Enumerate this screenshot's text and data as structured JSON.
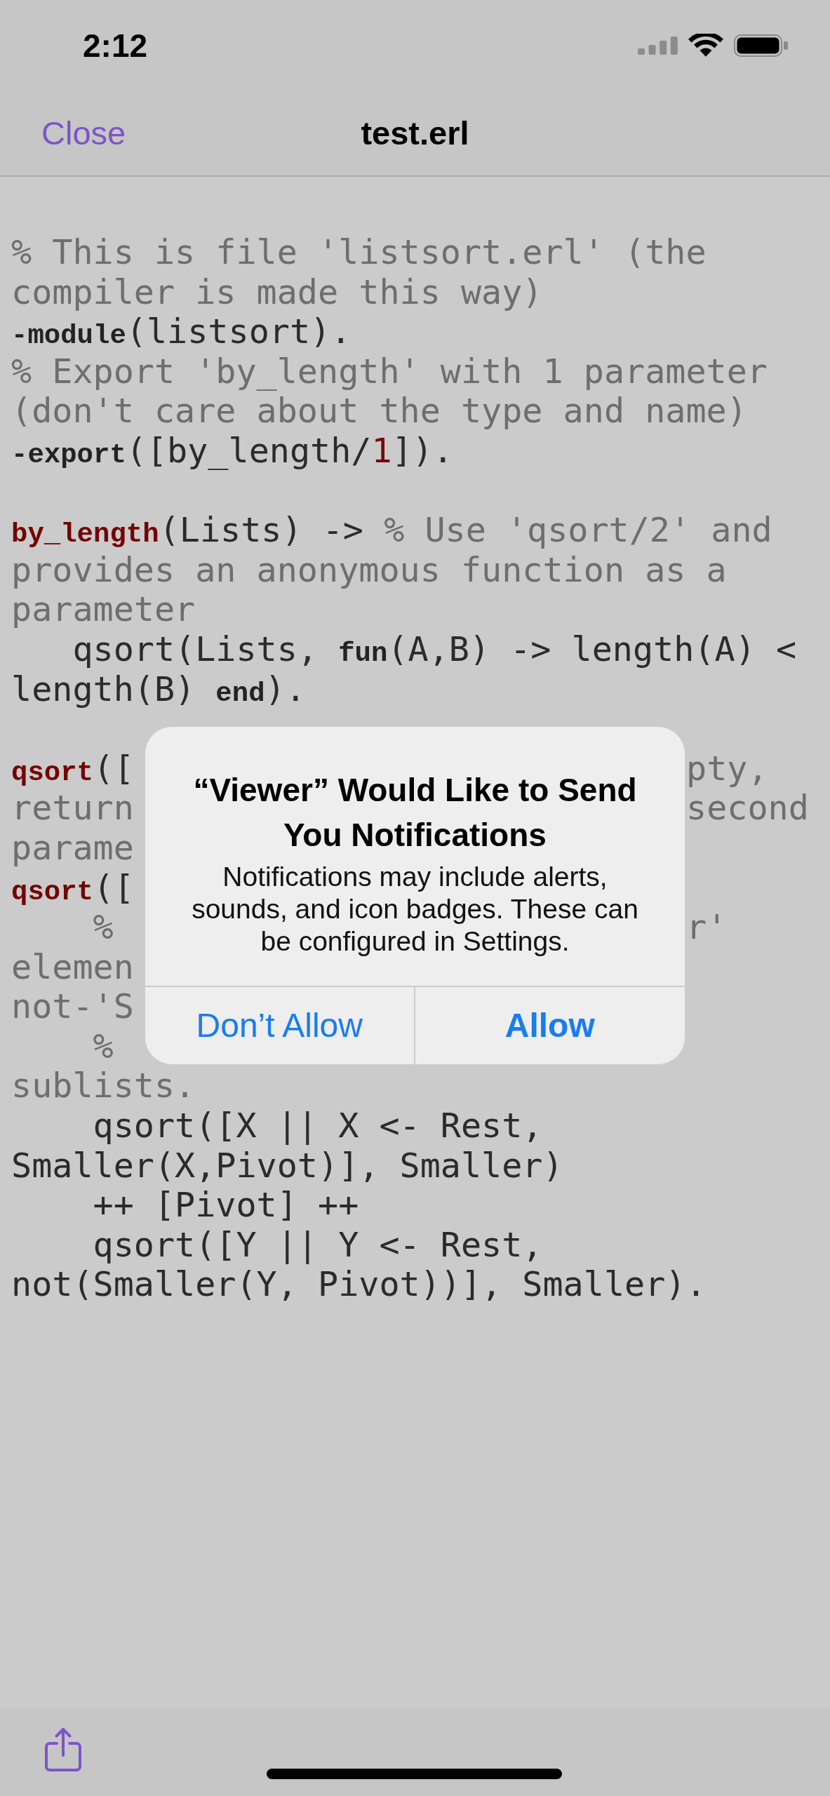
{
  "status_bar": {
    "time": "2:12"
  },
  "nav_bar": {
    "close_button": "Close",
    "title": "test.erl"
  },
  "editor": {
    "blocks": [
      {
        "lines": [
          {
            "tokens": [
              {
                "kind": "comment",
                "text": "% This is file 'listsort.erl' (the"
              }
            ]
          },
          {
            "tokens": [
              {
                "kind": "comment",
                "text": "compiler is made this way)"
              }
            ]
          },
          {
            "tokens": [
              {
                "kind": "keyword",
                "text": "-module"
              },
              {
                "kind": "plain",
                "text": "(listsort)."
              }
            ]
          },
          {
            "tokens": [
              {
                "kind": "comment",
                "text": "% Export 'by_length' with 1 parameter"
              }
            ]
          },
          {
            "tokens": [
              {
                "kind": "comment",
                "text": "(don't care about the type and name)"
              }
            ]
          },
          {
            "tokens": [
              {
                "kind": "keyword",
                "text": "-export"
              },
              {
                "kind": "plain",
                "text": "([by_length/"
              },
              {
                "kind": "number",
                "text": "1"
              },
              {
                "kind": "plain",
                "text": "])."
              }
            ]
          }
        ]
      },
      {
        "lines": [
          {
            "tokens": [
              {
                "kind": "function",
                "text": "by_length"
              },
              {
                "kind": "plain",
                "text": "(Lists) -> "
              },
              {
                "kind": "comment",
                "text": "% Use 'qsort/2' and"
              }
            ]
          },
          {
            "tokens": [
              {
                "kind": "comment",
                "text": "provides an anonymous function as a"
              }
            ]
          },
          {
            "tokens": [
              {
                "kind": "comment",
                "text": "parameter"
              }
            ]
          },
          {
            "tokens": [
              {
                "kind": "plain",
                "text": "   qsort(Lists, "
              },
              {
                "kind": "keyword",
                "text": "fun"
              },
              {
                "kind": "plain",
                "text": "(A,B) -> length(A) <"
              }
            ]
          },
          {
            "tokens": [
              {
                "kind": "plain",
                "text": "length(B) "
              },
              {
                "kind": "keyword",
                "text": "end"
              },
              {
                "kind": "plain",
                "text": ")."
              }
            ]
          }
        ]
      },
      {
        "lines": [
          {
            "tokens": [
              {
                "kind": "function",
                "text": "qsort"
              },
              {
                "kind": "plain",
                "text": "(["
              }
            ],
            "tokens_right": [
              {
                "kind": "comment",
                "text": "pty,"
              }
            ]
          },
          {
            "tokens": [
              {
                "kind": "comment",
                "text": "return"
              }
            ],
            "tokens_right": [
              {
                "kind": "comment",
                "text": "second"
              }
            ]
          },
          {
            "tokens": [
              {
                "kind": "comment",
                "text": "parame"
              }
            ]
          },
          {
            "tokens": [
              {
                "kind": "function",
                "text": "qsort"
              },
              {
                "kind": "plain",
                "text": "(["
              }
            ]
          },
          {
            "tokens": [
              {
                "kind": "comment",
                "text": "    %"
              }
            ],
            "tokens_right": [
              {
                "kind": "comment",
                "text": "r'"
              }
            ]
          },
          {
            "tokens": [
              {
                "kind": "comment",
                "text": "elemen"
              }
            ]
          },
          {
            "tokens": [
              {
                "kind": "comment",
                "text": "not-'S"
              }
            ]
          },
          {
            "tokens": [
              {
                "kind": "comment",
                "text": "    %"
              }
            ]
          },
          {
            "tokens": [
              {
                "kind": "comment",
                "text": "sublists."
              }
            ]
          },
          {
            "tokens": [
              {
                "kind": "plain",
                "text": "    qsort([X || X <- Rest,"
              }
            ]
          },
          {
            "tokens": [
              {
                "kind": "plain",
                "text": "Smaller(X,Pivot)], Smaller)"
              }
            ]
          },
          {
            "tokens": [
              {
                "kind": "plain",
                "text": "    ++ [Pivot] ++"
              }
            ]
          },
          {
            "tokens": [
              {
                "kind": "plain",
                "text": "    qsort([Y || Y <- Rest,"
              }
            ]
          },
          {
            "tokens": [
              {
                "kind": "plain",
                "text": "not(Smaller(Y, Pivot))], Smaller)."
              }
            ]
          }
        ]
      }
    ]
  },
  "alert": {
    "title": "“Viewer” Would Like to Send You Notifications",
    "message": "Notifications may include alerts, sounds, and icon badges. These can be configured in Settings.",
    "buttons": [
      {
        "label": "Don’t Allow",
        "preferred": false
      },
      {
        "label": "Allow",
        "preferred": true
      }
    ]
  }
}
